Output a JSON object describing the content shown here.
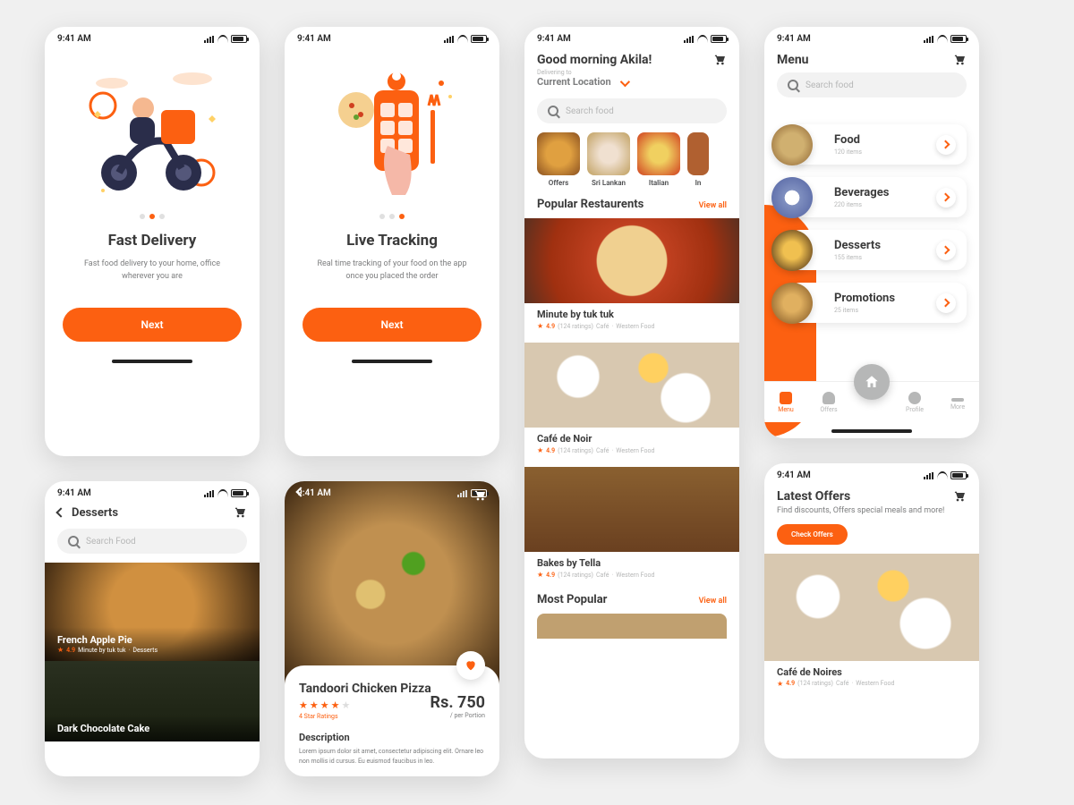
{
  "status": {
    "time": "9:41 AM"
  },
  "onboarding1": {
    "title": "Fast Delivery",
    "subtitle": "Fast food delivery to your home, office wherever you are",
    "cta": "Next",
    "active_dot": 1
  },
  "onboarding2": {
    "title": "Live Tracking",
    "subtitle": "Real time tracking of your food on the app once you placed the order",
    "cta": "Next",
    "active_dot": 2
  },
  "home": {
    "greeting": "Good morning Akila!",
    "delivering_label": "Delivering to",
    "delivering_value": "Current Location",
    "search_placeholder": "Search food",
    "categories": [
      {
        "label": "Offers"
      },
      {
        "label": "Sri Lankan"
      },
      {
        "label": "Italian"
      },
      {
        "label": "In"
      }
    ],
    "popular_title": "Popular Restaurents",
    "view_all": "View all",
    "restaurants": [
      {
        "name": "Minute by tuk tuk",
        "rating": "4.9",
        "rating_count": "(124 ratings)",
        "tag1": "Café",
        "tag2": "Western Food"
      },
      {
        "name": "Café de Noir",
        "rating": "4.9",
        "rating_count": "(124 ratings)",
        "tag1": "Café",
        "tag2": "Western Food"
      },
      {
        "name": "Bakes by Tella",
        "rating": "4.9",
        "rating_count": "(124 ratings)",
        "tag1": "Café",
        "tag2": "Western Food"
      }
    ],
    "most_popular_title": "Most Popular"
  },
  "menu": {
    "title": "Menu",
    "search_placeholder": "Search food",
    "items": [
      {
        "name": "Food",
        "count": "120 items"
      },
      {
        "name": "Beverages",
        "count": "220 items"
      },
      {
        "name": "Desserts",
        "count": "155 items"
      },
      {
        "name": "Promotions",
        "count": "25 items"
      }
    ],
    "tabs": [
      {
        "label": "Menu",
        "active": true
      },
      {
        "label": "Offers",
        "active": false
      },
      {
        "label": "Profile",
        "active": false
      },
      {
        "label": "More",
        "active": false
      }
    ]
  },
  "desserts": {
    "title": "Desserts",
    "search_placeholder": "Search Food",
    "items": [
      {
        "name": "French Apple Pie",
        "rating": "4.9",
        "vendor": "Minute by tuk tuk",
        "category": "Desserts"
      },
      {
        "name": "Dark Chocolate Cake",
        "rating": "",
        "vendor": "",
        "category": ""
      }
    ]
  },
  "detail": {
    "title": "Tandoori Chicken Pizza",
    "star_rating": 4,
    "star_label": "4 Star Ratings",
    "price": "Rs. 750",
    "price_unit": "/ per Portion",
    "desc_heading": "Description",
    "desc_text": "Lorem ipsum dolor sit amet, consectetur adipiscing elit. Ornare leo non mollis id cursus. Eu euismod faucibus in leo."
  },
  "offers": {
    "title": "Latest Offers",
    "subtitle": "Find discounts, Offers special meals and more!",
    "cta": "Check Offers",
    "restaurant": {
      "name": "Café de Noires",
      "rating": "4.9",
      "rating_count": "(124 ratings)",
      "tag1": "Café",
      "tag2": "Western Food"
    }
  }
}
